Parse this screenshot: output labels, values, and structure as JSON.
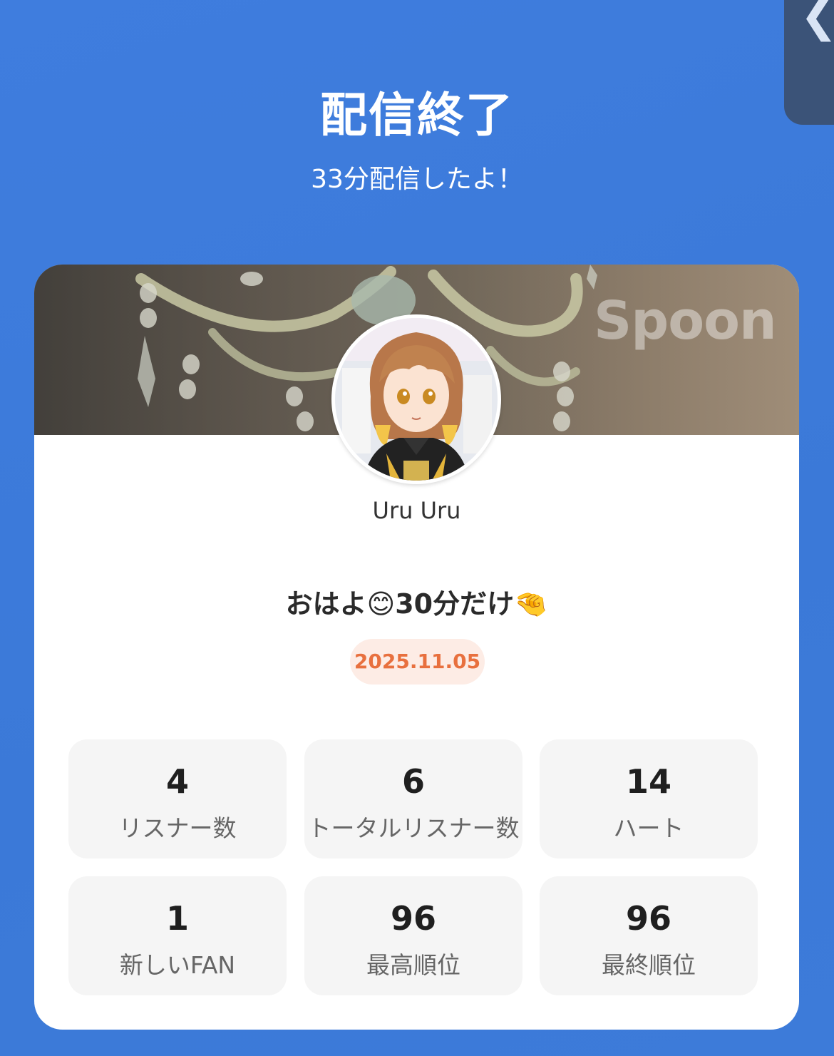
{
  "header": {
    "title": "配信終了",
    "subtitle": "33分配信したよ！"
  },
  "side_tab": {
    "icon": "chevron-left-icon",
    "glyph": "❮"
  },
  "card": {
    "brand_watermark": "Spoon",
    "username": "Uru Uru",
    "broadcast_title": "おはよ😊30分だけ🤏",
    "date": "2025.11.05"
  },
  "stats": [
    {
      "value": "4",
      "label": "リスナー数"
    },
    {
      "value": "6",
      "label": "トータルリスナー数"
    },
    {
      "value": "14",
      "label": "ハート"
    },
    {
      "value": "1",
      "label": "新しいFAN"
    },
    {
      "value": "96",
      "label": "最高順位"
    },
    {
      "value": "96",
      "label": "最終順位"
    }
  ],
  "colors": {
    "background": "#3d7bd9",
    "card": "#ffffff",
    "date_badge_bg": "#fdece5",
    "date_badge_text": "#e8703e",
    "stat_bg": "#f5f5f5"
  }
}
